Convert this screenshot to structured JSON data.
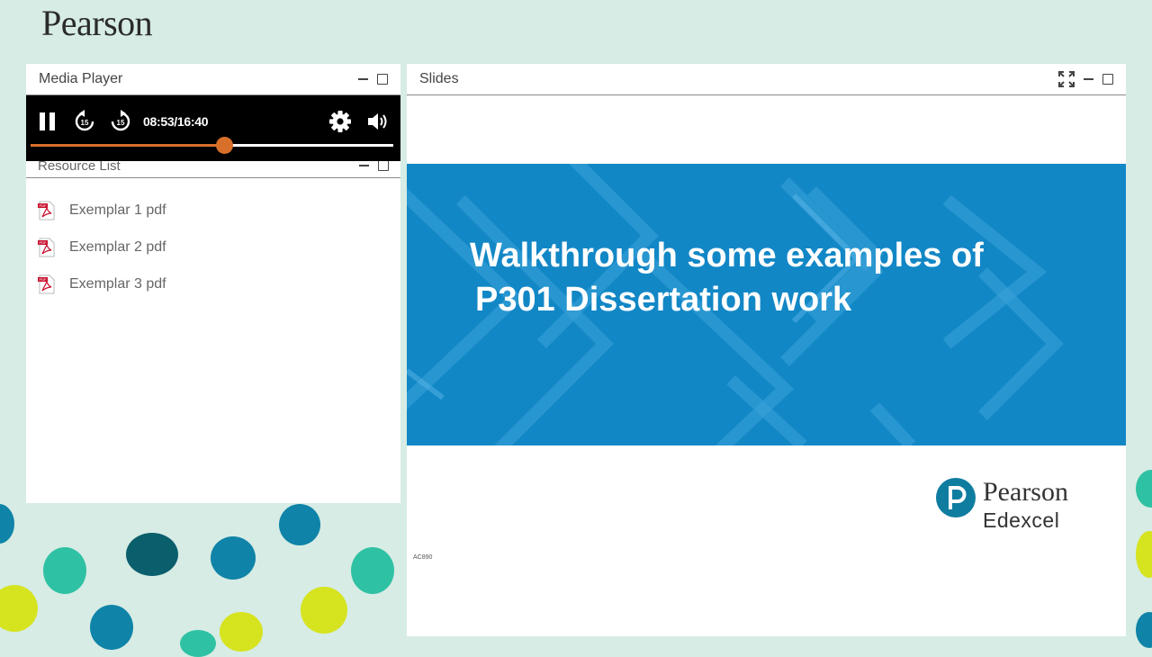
{
  "brand": {
    "name": "Pearson"
  },
  "media_player": {
    "title": "Media Player",
    "time_display": "08:53/16:40",
    "progress_fraction": 0.533,
    "accent_color": "#d9702a"
  },
  "resource_list": {
    "title": "Resource List",
    "items": [
      {
        "label": "Exemplar 1 pdf",
        "icon": "pdf-icon"
      },
      {
        "label": "Exemplar 2 pdf",
        "icon": "pdf-icon"
      },
      {
        "label": "Exemplar 3 pdf",
        "icon": "pdf-icon"
      }
    ]
  },
  "slides": {
    "title": "Slides",
    "slide_title_line1": "Walkthrough some examples of",
    "slide_title_line2": "P301 Dissertation work",
    "slide_code": "AC890",
    "logo_name": "Pearson",
    "logo_sub": "Edexcel",
    "banner_color": "#1287c6"
  }
}
